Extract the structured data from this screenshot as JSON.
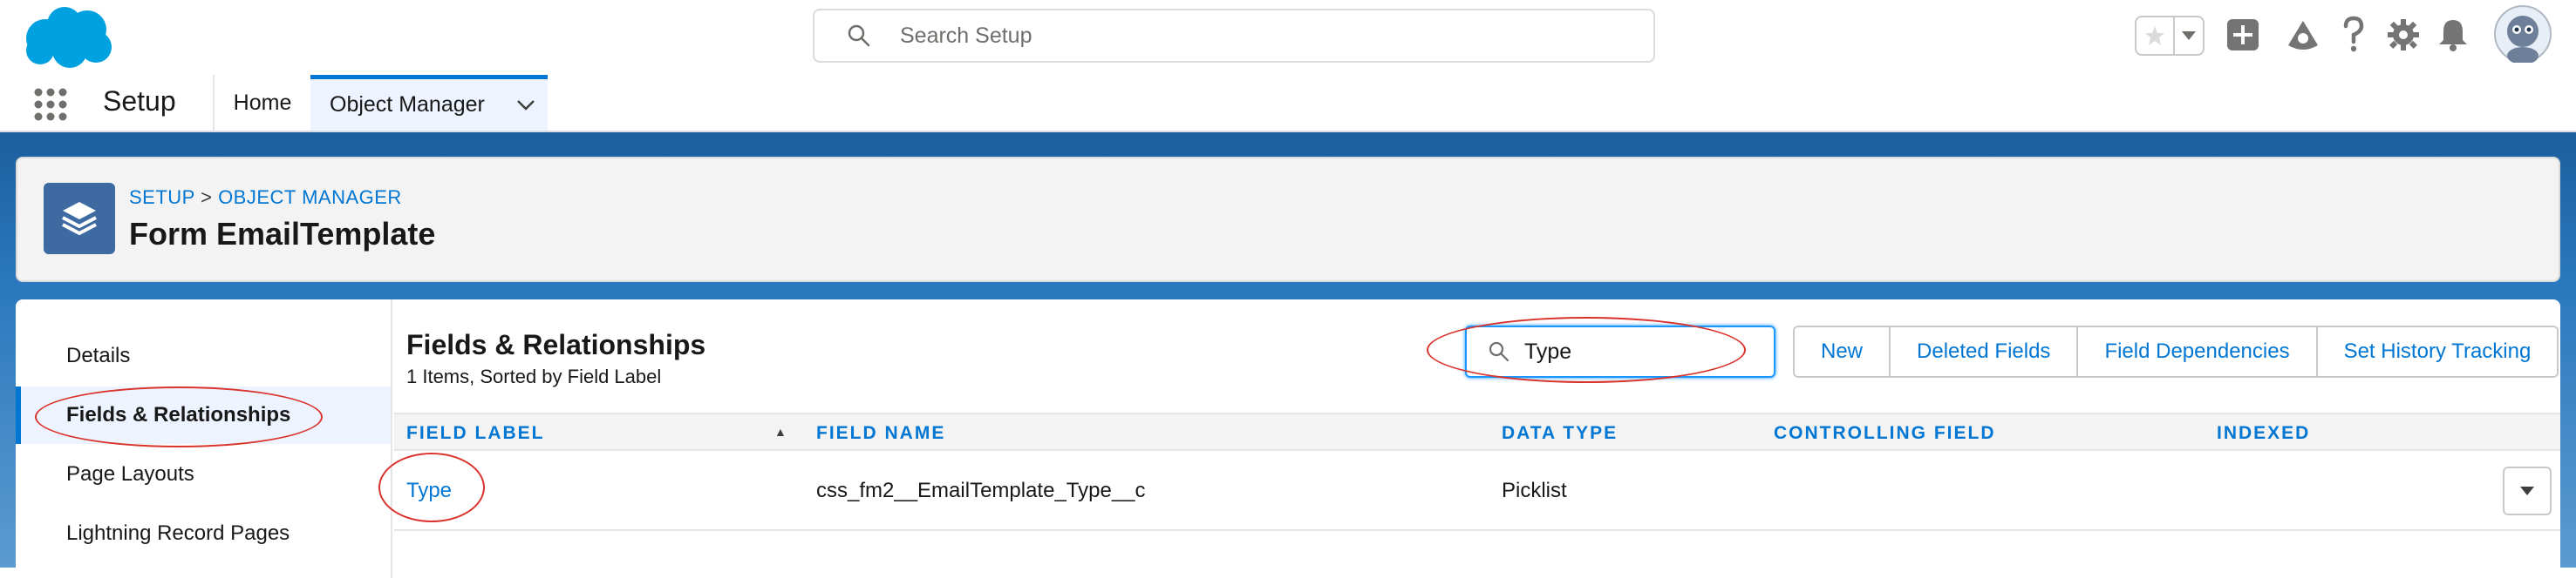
{
  "global_header": {
    "search_placeholder": "Search Setup",
    "icons": [
      "salesforce-cloud-logo",
      "search-icon",
      "favorite-star-icon",
      "favorites-dropdown-icon",
      "global-actions-add-icon",
      "trailhead-icon",
      "help-icon",
      "setup-gear-icon",
      "notifications-bell-icon",
      "user-avatar"
    ]
  },
  "nav": {
    "app_name": "Setup",
    "tabs": [
      {
        "label": "Home"
      },
      {
        "label": "Object Manager"
      }
    ]
  },
  "page_header": {
    "breadcrumb": {
      "setup": "SETUP",
      "separator": ">",
      "object_manager": "OBJECT MANAGER"
    },
    "title": "Form EmailTemplate"
  },
  "left_nav": {
    "items": [
      {
        "label": "Details"
      },
      {
        "label": "Fields & Relationships"
      },
      {
        "label": "Page Layouts"
      },
      {
        "label": "Lightning Record Pages"
      }
    ],
    "active_index": 1
  },
  "main": {
    "title": "Fields & Relationships",
    "subtitle": "1 Items, Sorted by Field Label",
    "quick_find_value": "Type",
    "buttons": [
      {
        "label": "New"
      },
      {
        "label": "Deleted Fields"
      },
      {
        "label": "Field Dependencies"
      },
      {
        "label": "Set History Tracking"
      }
    ],
    "columns": [
      "FIELD LABEL",
      "FIELD NAME",
      "DATA TYPE",
      "CONTROLLING FIELD",
      "INDEXED"
    ],
    "rows": [
      {
        "field_label": "Type",
        "field_name": "css_fm2__EmailTemplate_Type__c",
        "data_type": "Picklist",
        "controlling_field": "",
        "indexed": ""
      }
    ]
  },
  "colors": {
    "brand_blue": "#0176d3",
    "annotation_red": "#d9332b",
    "header_band": "#2a78bd"
  }
}
